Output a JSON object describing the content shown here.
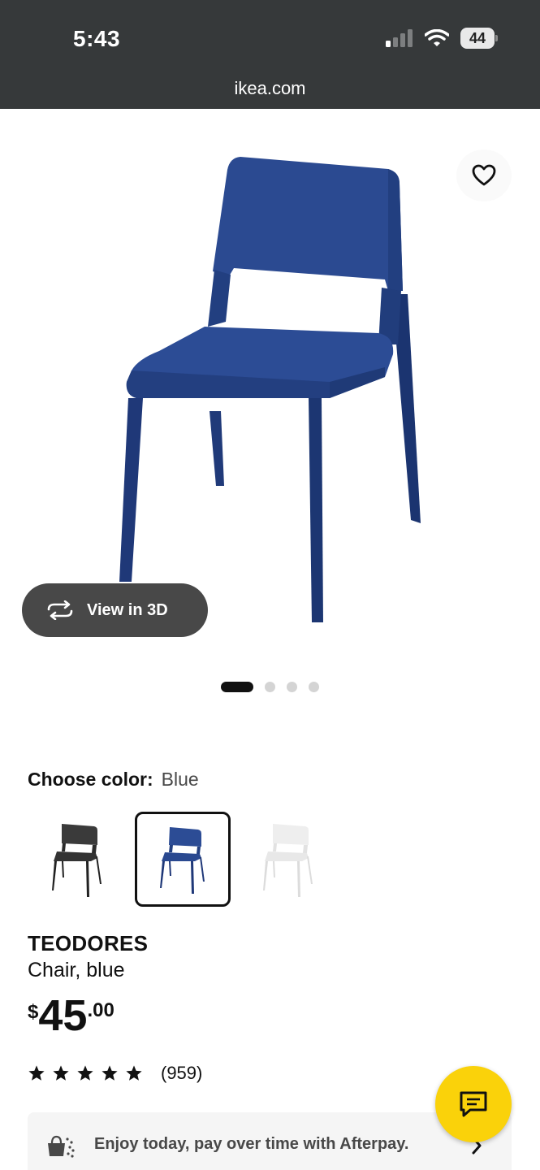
{
  "status_bar": {
    "time": "5:43",
    "battery_level": "44",
    "icons": [
      "cellular-signal-icon",
      "wifi-icon",
      "battery-icon"
    ],
    "background": "#36393a"
  },
  "browser": {
    "url": "ikea.com"
  },
  "product_image": {
    "alt": "Blue chair",
    "icons": [
      "heart-icon",
      "rotate-3d-icon"
    ],
    "view_3d_label": "View in 3D",
    "carousel": {
      "total_slides": 4,
      "active_index": 0
    }
  },
  "color_picker": {
    "label": "Choose color:",
    "selected_value": "Blue",
    "options": [
      {
        "name": "Black",
        "color": "#2b2b2b",
        "selected": false
      },
      {
        "name": "Blue",
        "color": "#1f3f85",
        "selected": true
      },
      {
        "name": "White",
        "color": "#f1f1f1",
        "selected": false
      }
    ]
  },
  "product": {
    "name": "TEODORES",
    "description": "Chair, blue",
    "price": {
      "currency": "$",
      "integer": "45",
      "decimal": ".00"
    },
    "rating": {
      "stars": 5,
      "count_label": "(959)"
    }
  },
  "afterpay": {
    "text": "Enjoy today, pay over time with Afterpay.",
    "icons": [
      "shopping-bag-icon",
      "chevron-right-icon"
    ]
  },
  "chat": {
    "icon": "chat-bubble-icon",
    "accent": "#fad20a"
  },
  "colors": {
    "chair_blue": "#1f3f85",
    "button_dark": "#484848"
  }
}
